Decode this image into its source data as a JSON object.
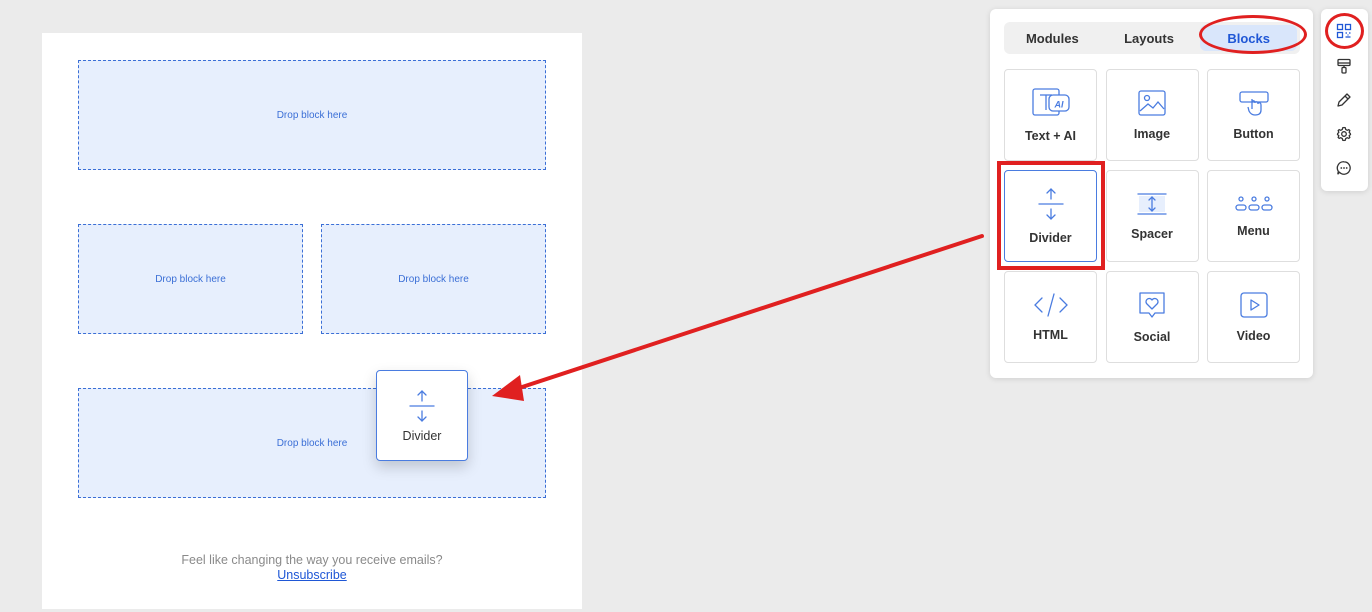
{
  "email": {
    "drop_label": "Drop block here",
    "footer_text": "Feel like changing the way you receive emails?",
    "unsubscribe": "Unsubscribe"
  },
  "drag_ghost": {
    "label": "Divider",
    "icon": "divider-icon"
  },
  "panel": {
    "tabs": [
      {
        "label": "Modules",
        "active": false
      },
      {
        "label": "Layouts",
        "active": false
      },
      {
        "label": "Blocks",
        "active": true
      }
    ],
    "blocks": [
      {
        "label": "Text + AI",
        "icon": "text-ai-icon"
      },
      {
        "label": "Image",
        "icon": "image-icon"
      },
      {
        "label": "Button",
        "icon": "button-icon"
      },
      {
        "label": "Divider",
        "icon": "divider-icon",
        "selected": true
      },
      {
        "label": "Spacer",
        "icon": "spacer-icon"
      },
      {
        "label": "Menu",
        "icon": "menu-icon"
      },
      {
        "label": "HTML",
        "icon": "html-icon"
      },
      {
        "label": "Social",
        "icon": "social-icon"
      },
      {
        "label": "Video",
        "icon": "video-icon"
      }
    ]
  },
  "sidebar": {
    "icons": [
      "blocks-grid-icon",
      "paint-roller-icon",
      "pencil-icon",
      "gear-icon",
      "chat-icon"
    ],
    "active": "blocks-grid-icon"
  },
  "colors": {
    "accent": "#1f57d6",
    "drop_zone_bg": "#e7effd",
    "drop_zone_border": "#3b6fd6",
    "annotation_red": "#e02020",
    "canvas_bg": "#ebebeb"
  }
}
